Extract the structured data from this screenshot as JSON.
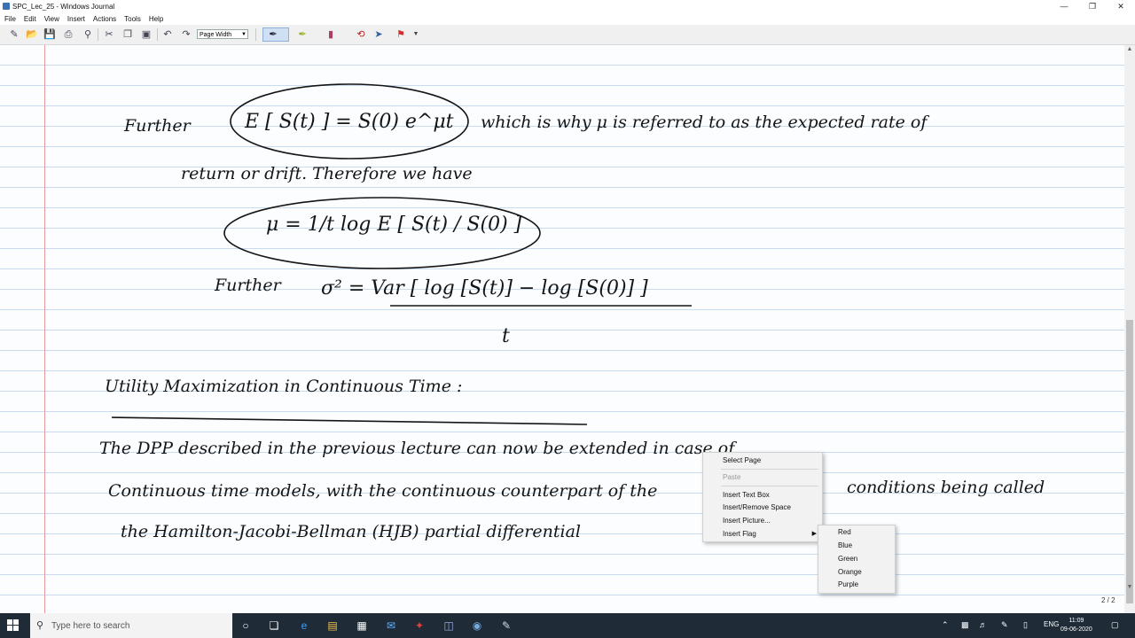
{
  "window": {
    "title": "SPC_Lec_25 - Windows Journal"
  },
  "menu": [
    "File",
    "Edit",
    "View",
    "Insert",
    "Actions",
    "Tools",
    "Help"
  ],
  "toolbar": {
    "zoom_value": "Page Width"
  },
  "notes": {
    "line1_a": "Further",
    "line1_formula": "E [ S(t) ] = S(0) e^μt",
    "line1_b": "which is why μ is referred to as the expected rate of",
    "line2": "return or drift. Therefore we have",
    "formula_mu": "μ = 1/t log E [ S(t) / S(0) ]",
    "line3_a": "Further",
    "formula_sigma": "σ² = Var [ log [S(t)] − log [S(0)] ]",
    "formula_sigma_den": "t",
    "heading": "Utility Maximization in Continuous Time :",
    "para1": "The DPP described in the previous lecture can now be extended in case of",
    "para2_a": "Continuous time models, with the continuous counterpart of the",
    "para2_b": "conditions being called",
    "para3": "the Hamilton-Jacobi-Bellman (HJB) partial differential"
  },
  "context_menu": {
    "select_page": "Select Page",
    "paste": "Paste",
    "insert_text_box": "Insert Text Box",
    "insert_remove_space": "Insert/Remove Space",
    "insert_picture": "Insert Picture...",
    "insert_flag": "Insert Flag"
  },
  "flag_submenu": [
    "Red",
    "Blue",
    "Green",
    "Orange",
    "Purple"
  ],
  "page_indicator": "2 / 2",
  "taskbar": {
    "search_placeholder": "Type here to search",
    "language": "ENG",
    "time": "11:09",
    "date": "09-06-2020"
  }
}
